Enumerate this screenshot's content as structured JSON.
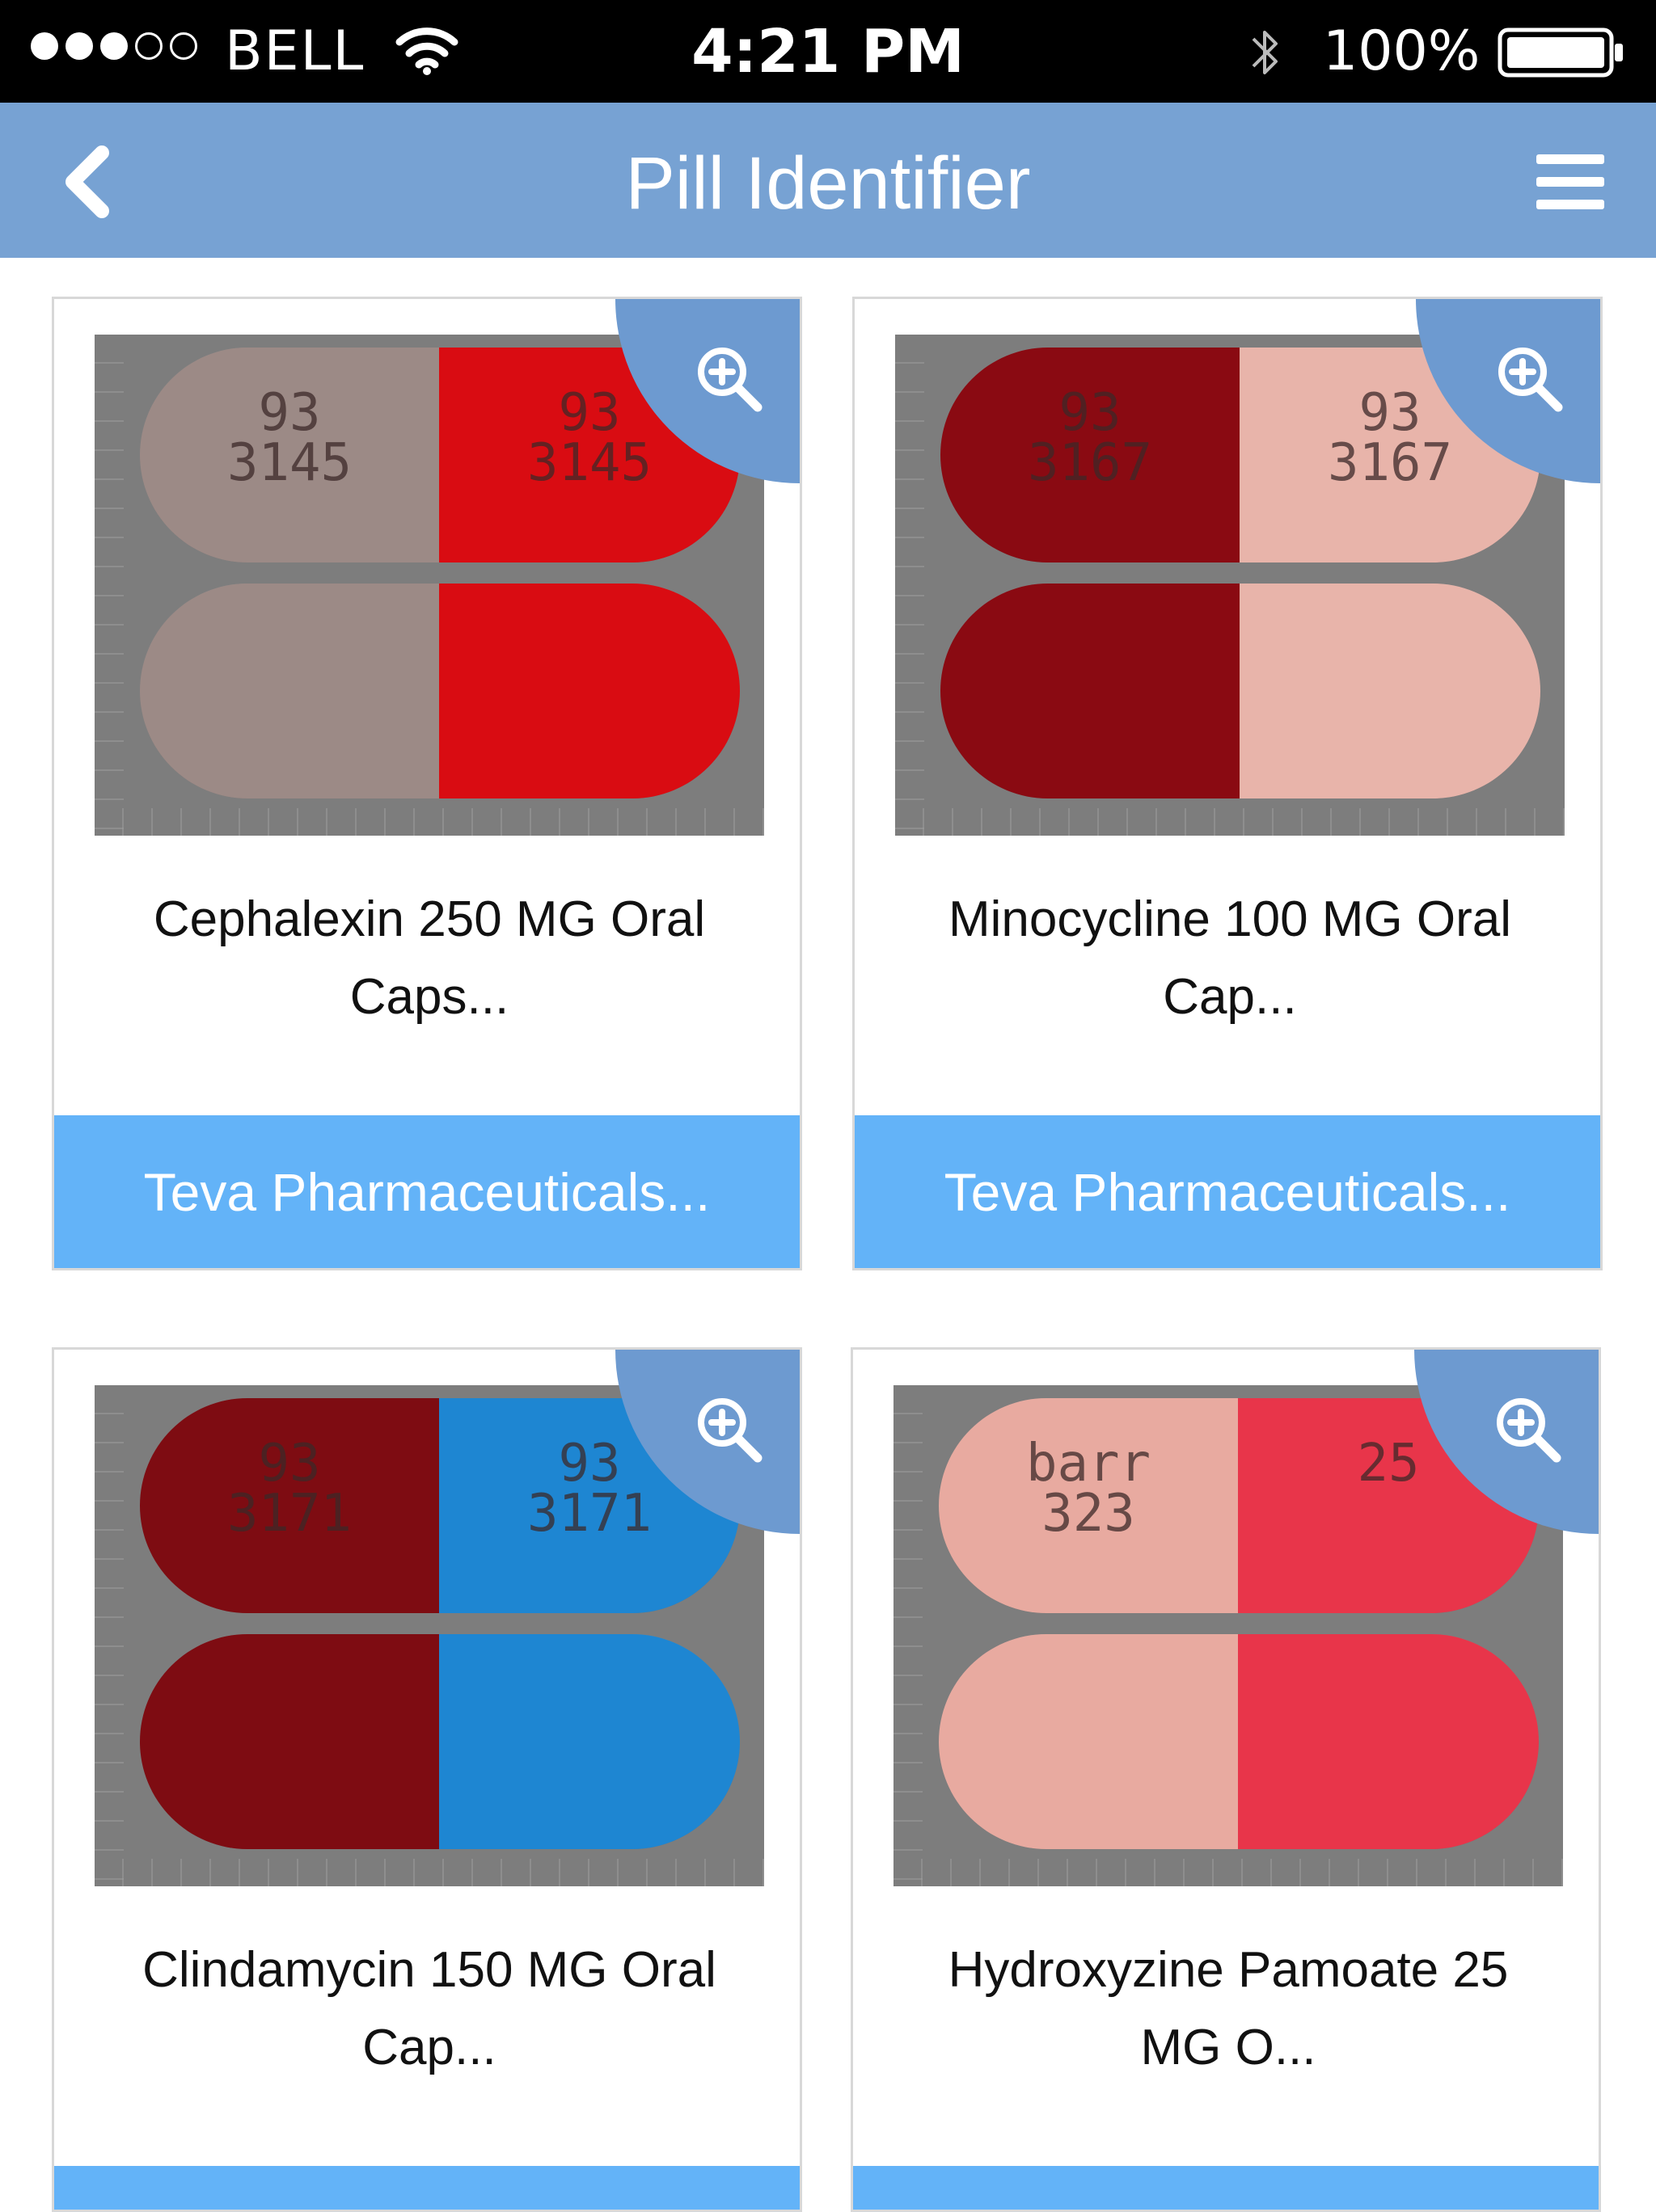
{
  "status_bar": {
    "carrier": "BELL",
    "time": "4:21 PM",
    "battery_percent": "100%",
    "signal_bars": 3,
    "signal_bars_total": 5
  },
  "nav": {
    "title": "Pill Identifier",
    "back_icon": "chevron-left-icon",
    "menu_icon": "hamburger-menu-icon",
    "background_color": "#77a2d3"
  },
  "pills": [
    {
      "name": "Cephalexin 250 MG Oral Caps...",
      "manufacturer": "Teva Pharmaceuticals...",
      "imprint_left": "93\n3145",
      "imprint_right": "93\n3145",
      "color_left": "#9c8a86",
      "color_right": "#d90c12"
    },
    {
      "name": "Minocycline 100 MG Oral Cap...",
      "manufacturer": "Teva Pharmaceuticals...",
      "imprint_left": "93\n3167",
      "imprint_right": "93\n3167",
      "color_left": "#8a0a12",
      "color_right": "#e8b4aa"
    },
    {
      "name": "Clindamycin 150 MG Oral Cap...",
      "manufacturer": "",
      "imprint_left": "93\n3171",
      "imprint_right": "93\n3171",
      "color_left": "#7e0c12",
      "color_right": "#1e86d2"
    },
    {
      "name": "Hydroxyzine Pamoate 25 MG O...",
      "manufacturer": "",
      "imprint_left": "barr\n323",
      "imprint_right": "25",
      "color_left": "#e8aaa0",
      "color_right": "#e8354a"
    }
  ],
  "colors": {
    "manufacturer_bar": "#63b3f8",
    "zoom_badge": "#6d9ad0"
  },
  "icons": {
    "zoom": "zoom-in-icon",
    "wifi": "wifi-icon",
    "bluetooth": "bluetooth-icon",
    "battery": "battery-icon"
  }
}
